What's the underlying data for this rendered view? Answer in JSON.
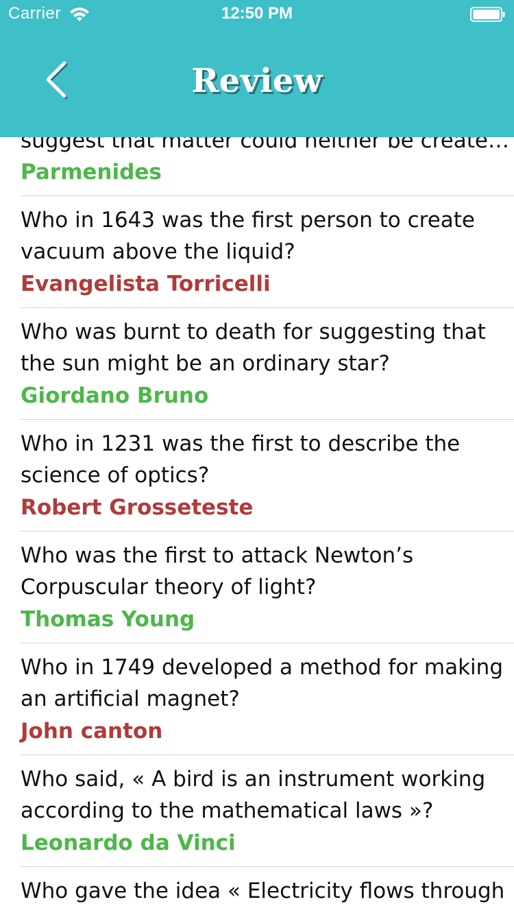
{
  "status_bar": {
    "carrier": "Carrier",
    "time": "12:50 PM"
  },
  "header": {
    "title": "Review",
    "background_color": "#3fbfc8",
    "back_icon": "chevron-left-icon"
  },
  "colors": {
    "correct": "#4cb848",
    "wrong": "#b23a3a"
  },
  "items": [
    {
      "question_lines": [
        "suggest that matter could neither be create…"
      ],
      "answer": "Parmenides",
      "status": "correct"
    },
    {
      "question_lines": [
        "Who in 1643 was the first person to create",
        "vacuum above the liquid?"
      ],
      "answer": "Evangelista Torricelli",
      "status": "wrong"
    },
    {
      "question_lines": [
        "Who was burnt to death for suggesting that",
        "the sun might be an ordinary star?"
      ],
      "answer": "Giordano Bruno",
      "status": "correct"
    },
    {
      "question_lines": [
        "Who in 1231 was the first to describe the",
        "science of optics?"
      ],
      "answer": "Robert Grosseteste",
      "status": "wrong"
    },
    {
      "question_lines": [
        "Who was the first to attack Newton’s",
        "Corpuscular theory of light?"
      ],
      "answer": "Thomas Young",
      "status": "correct"
    },
    {
      "question_lines": [
        "Who in 1749 developed a method for making",
        "an artificial magnet?"
      ],
      "answer": "John canton",
      "status": "wrong"
    },
    {
      "question_lines": [
        "Who said, « A bird is an instrument working",
        "according to the mathematical laws »?"
      ],
      "answer": "Leonardo da Vinci",
      "status": "correct"
    },
    {
      "question_lines": [
        "Who gave the idea « Electricity flows through"
      ],
      "answer": "",
      "status": ""
    }
  ]
}
